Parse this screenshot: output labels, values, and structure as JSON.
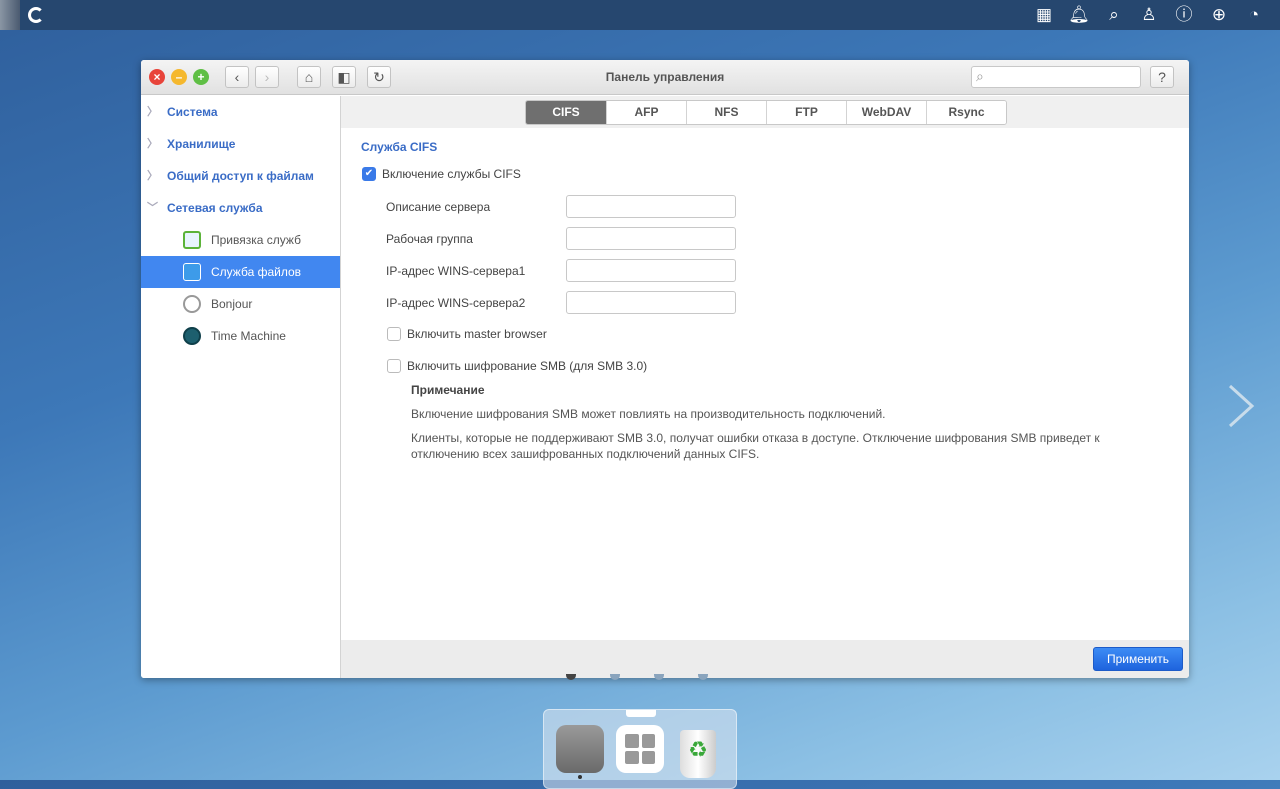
{
  "topbar": {
    "icons": [
      "apps-grid-icon",
      "bell-icon",
      "search-icon",
      "user-icon",
      "help-icon",
      "globe-icon",
      "dashboard-icon"
    ]
  },
  "window": {
    "title": "Панель управления",
    "search_placeholder": ""
  },
  "sidebar": {
    "groups": [
      {
        "label": "Система",
        "expanded": false
      },
      {
        "label": "Хранилище",
        "expanded": false
      },
      {
        "label": "Общий доступ к файлам",
        "expanded": false
      },
      {
        "label": "Сетевая служба",
        "expanded": true
      }
    ],
    "subitems": [
      {
        "label": "Привязка служб"
      },
      {
        "label": "Служба файлов",
        "active": true
      },
      {
        "label": "Bonjour"
      },
      {
        "label": "Time Machine"
      }
    ]
  },
  "tabs": [
    {
      "label": "CIFS",
      "active": true
    },
    {
      "label": "AFP"
    },
    {
      "label": "NFS"
    },
    {
      "label": "FTP"
    },
    {
      "label": "WebDAV"
    },
    {
      "label": "Rsync"
    }
  ],
  "cifs": {
    "heading": "Служба CIFS",
    "enable_label": "Включение службы CIFS",
    "enable_checked": true,
    "fields": [
      {
        "label": "Описание сервера",
        "value": ""
      },
      {
        "label": "Рабочая группа",
        "value": ""
      },
      {
        "label": "IP-адрес WINS-сервера1",
        "value": ""
      },
      {
        "label": "IP-адрес WINS-сервера2",
        "value": ""
      }
    ],
    "master_browser_label": "Включить master browser",
    "master_browser_checked": false,
    "smb_encrypt_label": "Включить шифрование SMB (для SMB 3.0)",
    "smb_encrypt_checked": false,
    "note_title": "Примечание",
    "note_1": "Включение шифрования SMB может повлиять на производительность подключений.",
    "note_2": "Клиенты, которые не поддерживают SMB 3.0, получат ошибки отказа в доступе. Отключение шифрования SMB приведет к отключению всех зашифрованных подключений данных CIFS."
  },
  "footer": {
    "apply_label": "Применить"
  },
  "colors": {
    "accent": "#3a6cc6",
    "active": "#4187f0",
    "topbar": "#26476f"
  }
}
